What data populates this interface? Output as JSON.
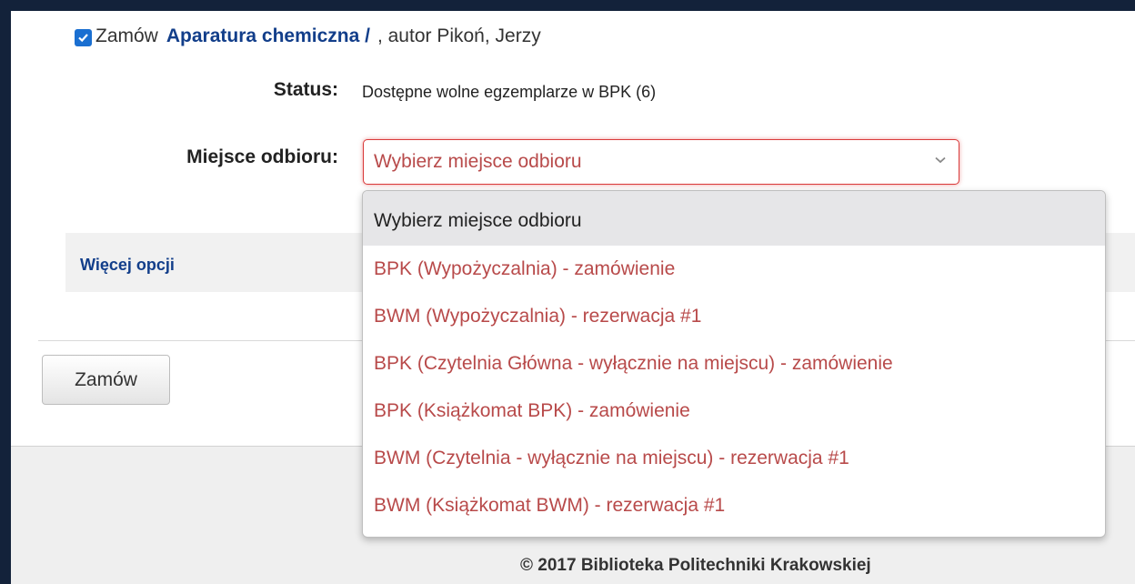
{
  "order_line": {
    "checkbox_label": "Zamów",
    "title": "Aparatura chemiczna /",
    "author": ", autor Pikoń, Jerzy"
  },
  "status": {
    "label": "Status:",
    "value": "Dostępne wolne egzemplarze w BPK (6)"
  },
  "pickup": {
    "label": "Miejsce odbioru:",
    "selected": "Wybierz miejsce odbioru",
    "options": [
      "Wybierz miejsce odbioru",
      "BPK (Wypożyczalnia) - zamówienie",
      "BWM (Wypożyczalnia) - rezerwacja #1",
      "BPK (Czytelnia Główna - wyłącznie na miejscu) - zamówienie",
      "BPK (Książkomat BPK) - zamówienie",
      "BWM (Czytelnia - wyłącznie na miejscu) - rezerwacja #1",
      "BWM (Książkomat BWM) - rezerwacja #1"
    ]
  },
  "more_options": "Więcej opcji",
  "order_button": "Zamów",
  "footer": "© 2017 Biblioteka Politechniki Krakowskiej",
  "colors": {
    "link": "#123e8a",
    "option_text": "#b84a4a",
    "checkbox": "#1a6fd1",
    "invalid_border": "#d93a3a"
  }
}
